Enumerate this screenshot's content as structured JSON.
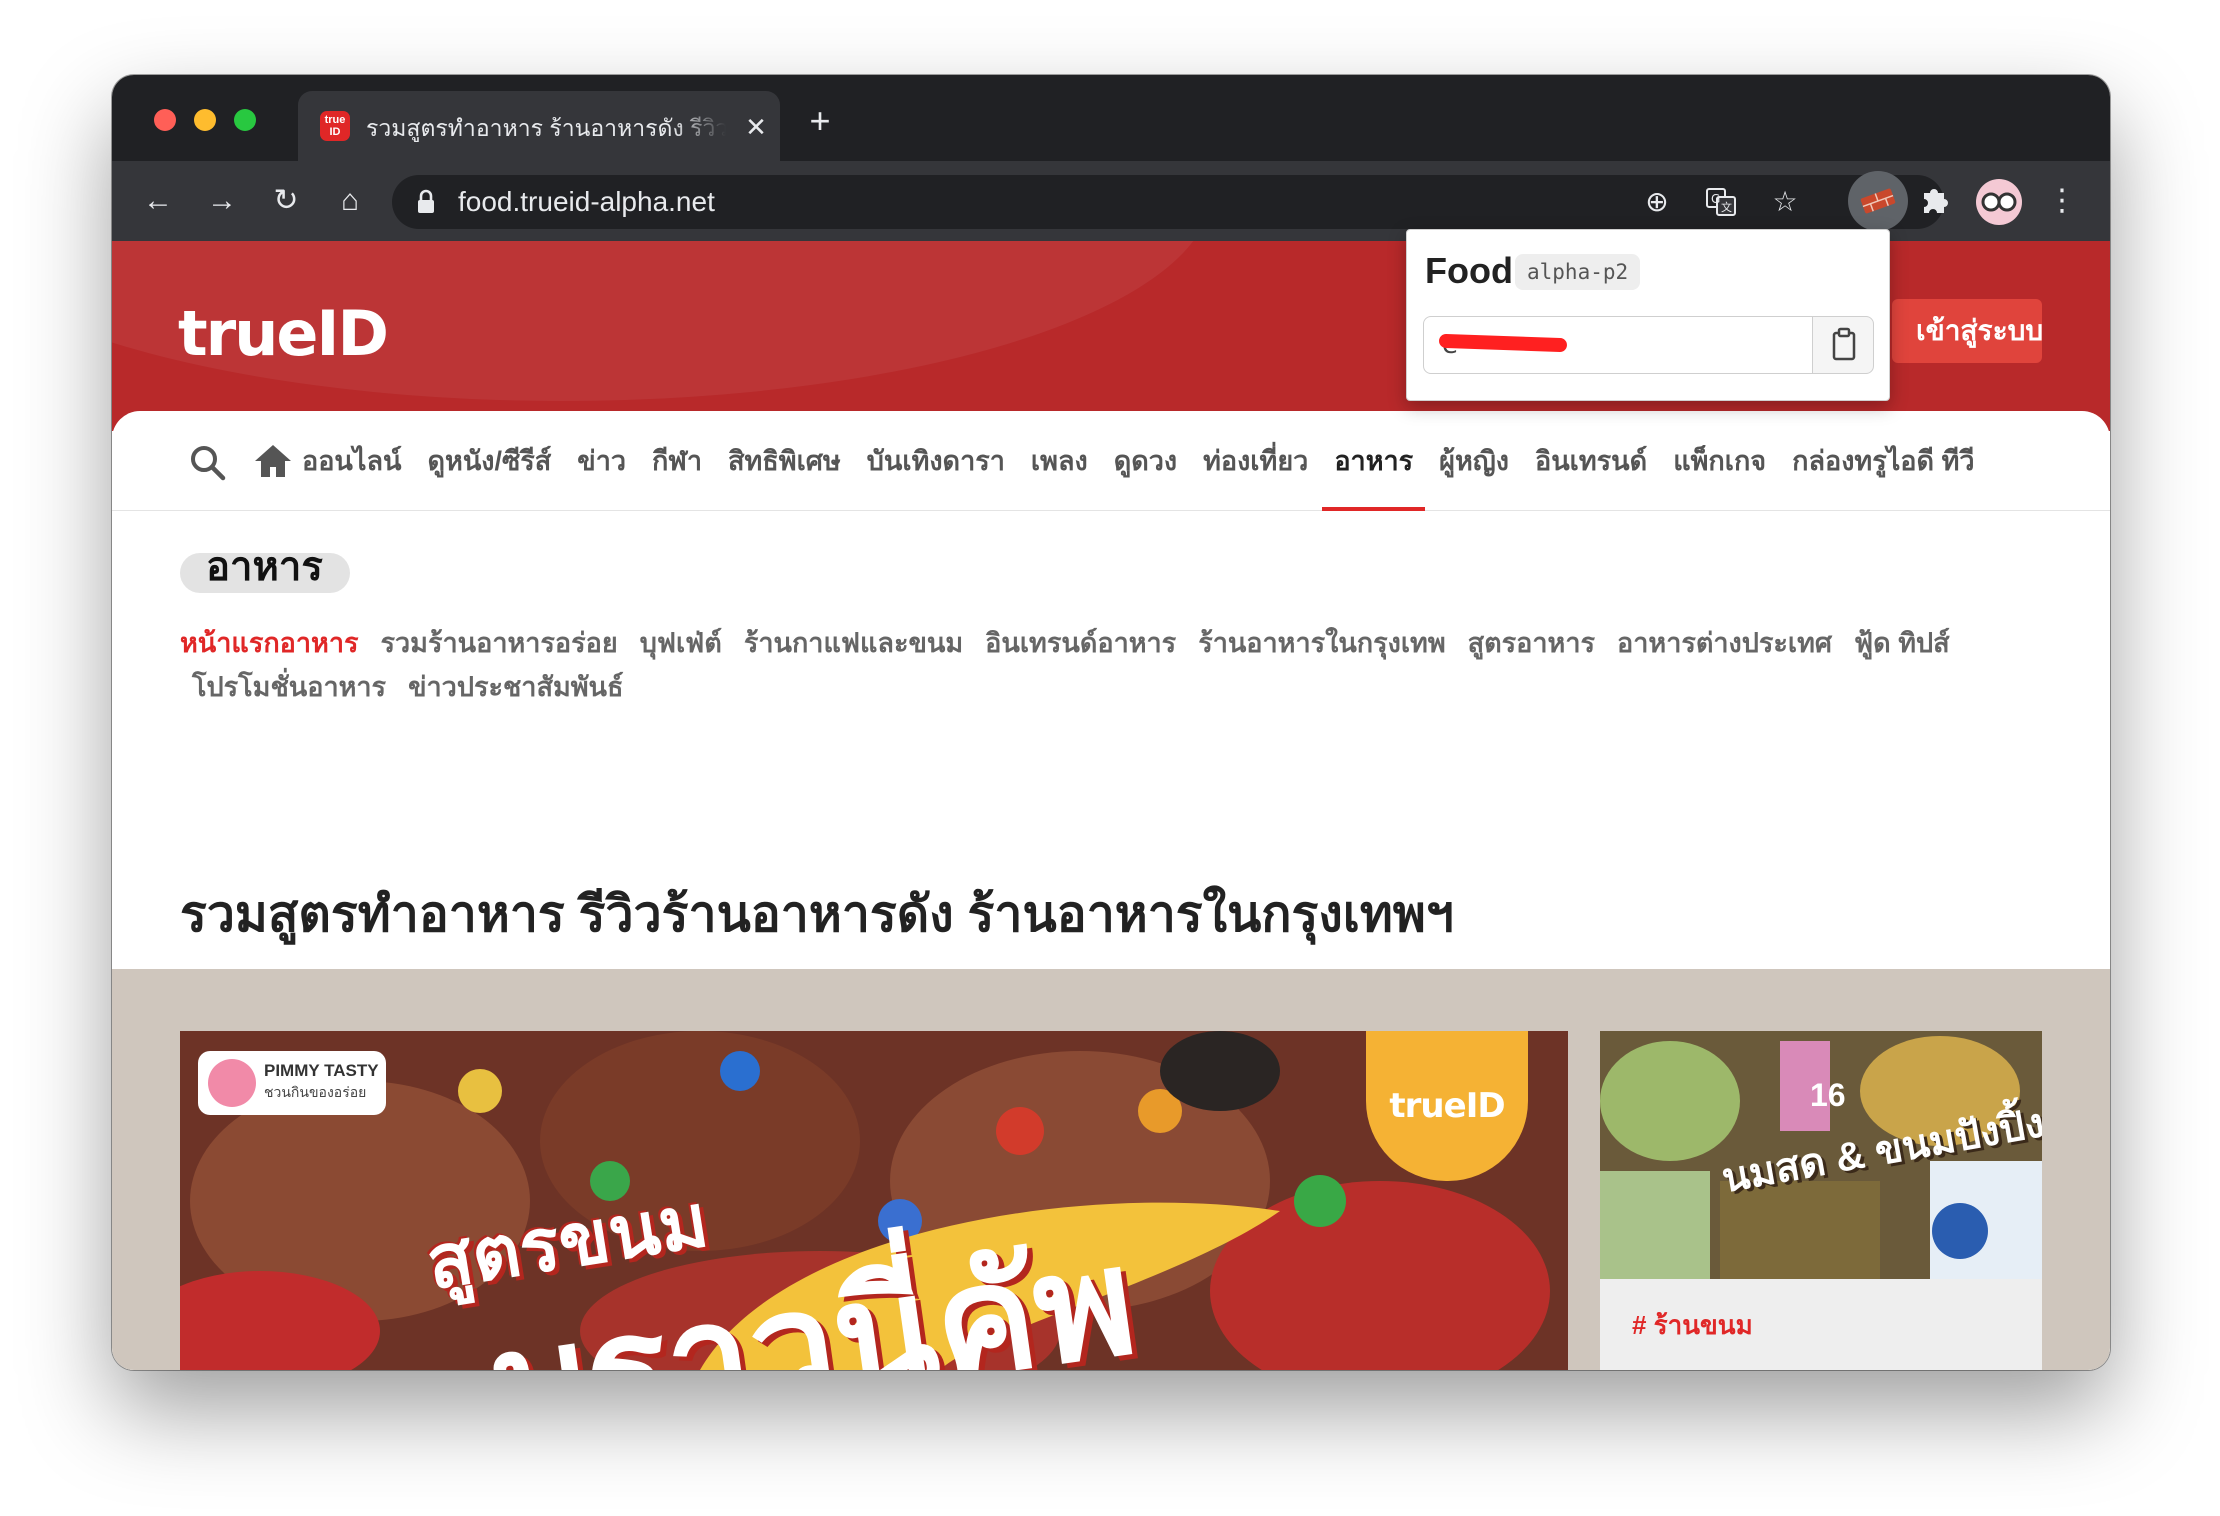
{
  "browser": {
    "tab": {
      "favicon_text": "true ID",
      "title": "รวมสูตรทำอาหาร ร้านอาหารดัง รีวิวร้านอาหาร",
      "close_glyph": "✕"
    },
    "new_tab_glyph": "+",
    "url": "food.trueid-alpha.net",
    "icons": {
      "back": "←",
      "forward": "→",
      "reload": "↻",
      "home": "⌂",
      "install": "⊕",
      "translate": "translate-icon",
      "bookmark": "☆",
      "extension_active": "brick-icon",
      "extensions": "puzzle-icon",
      "menu": "⋮"
    }
  },
  "site": {
    "logo": "trueID",
    "login_label": "เข้าสู่ระบบ",
    "nav": {
      "items": [
        "ออนไลน์",
        "ดูหนัง/ซีรีส์",
        "ข่าว",
        "กีฬา",
        "สิทธิพิเศษ",
        "บันเทิงดารา",
        "เพลง",
        "ดูดวง",
        "ท่องเที่ยว",
        "อาหาร",
        "ผู้หญิง",
        "อินเทรนด์",
        "แพ็กเกจ",
        "กล่องทรูไอดี ทีวี"
      ],
      "active_index": 9
    },
    "section_title": "อาหาร",
    "sub_nav": {
      "row1": [
        "หน้าแรกอาหาร",
        "รวมร้านอาหารอร่อย",
        "บุฟเฟ่ต์",
        "ร้านกาแฟและขนม",
        "อินเทรนด์อาหาร",
        "ร้านอาหารในกรุงเทพ",
        "สูตรอาหาร",
        "อาหารต่างประเทศ",
        "ฟู้ด ทิปส์"
      ],
      "row2": [
        "โปรโมชั่นอาหาร",
        "ข่าวประชาสัมพันธ์"
      ]
    },
    "main_title": "รวมสูตรทำอาหาร รีวิวร้านอาหารดัง ร้านอาหารในกรุงเทพฯ",
    "feature": {
      "badge_name": "PIMMY TASTY",
      "badge_sub": "ชวนกินของอร่อย",
      "brand_badge": "trueID",
      "promo_line1": "สูตรขนม",
      "promo_line2": "บราวนี่คัพ"
    },
    "side_card": {
      "number": "16",
      "promo": "นมสด & ขนมปังปิ้ง",
      "tag": "# ร้านขนม"
    }
  },
  "popup": {
    "title": "Food",
    "env_badge": "alpha-p2",
    "field_value": "e"
  },
  "colors": {
    "brand_red": "#b8292a",
    "accent_red": "#e02727",
    "chrome_dark": "#202124",
    "chrome_toolbar": "#35363a"
  }
}
